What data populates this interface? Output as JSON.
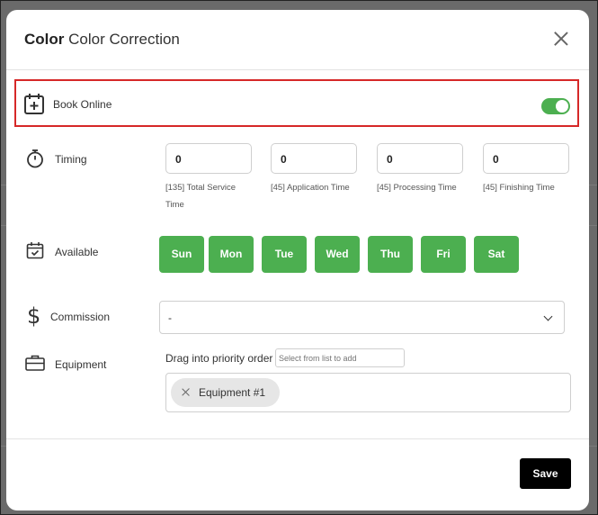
{
  "modal": {
    "title_bold": "Color",
    "title_rest": "Color Correction"
  },
  "book_online": {
    "label": "Book Online",
    "enabled": true
  },
  "timing": {
    "label": "Timing",
    "fields": [
      {
        "value": "0",
        "caption_line1": "[135] Total Service",
        "caption_line2": "Time"
      },
      {
        "value": "0",
        "caption_line1": "[45] Application Time",
        "caption_line2": ""
      },
      {
        "value": "0",
        "caption_line1": "[45] Processing Time",
        "caption_line2": ""
      },
      {
        "value": "0",
        "caption_line1": "[45] Finishing Time",
        "caption_line2": ""
      }
    ]
  },
  "available": {
    "label": "Available",
    "days": [
      "Sun",
      "Mon",
      "Tue",
      "Wed",
      "Thu",
      "Fri",
      "Sat"
    ]
  },
  "commission": {
    "label": "Commission",
    "selected": "-"
  },
  "equipment": {
    "label": "Equipment",
    "drag_label": "Drag into priority order",
    "add_placeholder": "Select from list to add",
    "items": [
      "Equipment #1"
    ]
  },
  "footer": {
    "save_label": "Save"
  },
  "colors": {
    "accent_green": "#4caf50",
    "highlight_red": "#d62828",
    "save_black": "#000000"
  }
}
